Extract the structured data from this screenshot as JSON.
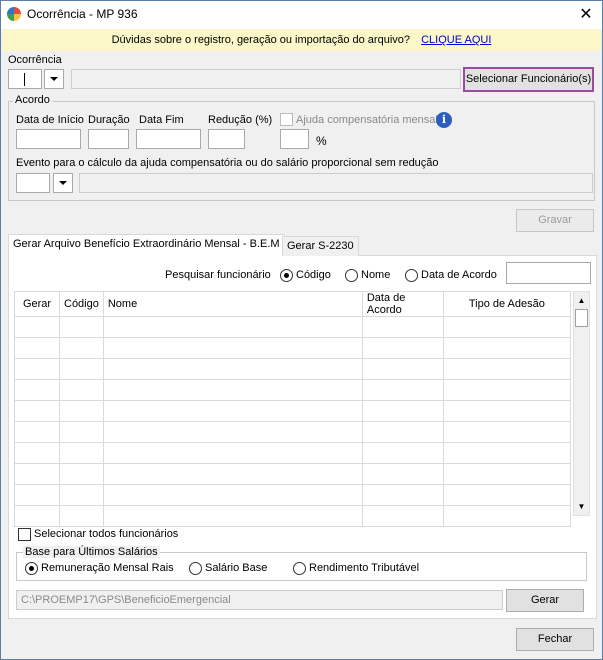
{
  "window": {
    "title": "Ocorrência - MP 936"
  },
  "banner": {
    "text": "Dúvidas sobre o registro, geração ou importação do arquivo?",
    "link": "CLIQUE AQUI"
  },
  "ocorrencia": {
    "label": "Ocorrência",
    "select_button": "Selecionar Funcionário(s)"
  },
  "acordo": {
    "legend": "Acordo",
    "fields": {
      "data_inicio": "Data de Início",
      "duracao": "Duração",
      "data_fim": "Data Fim",
      "reducao": "Redução (%)"
    },
    "ajuda_label": "Ajuda compensatória mensal",
    "percent": "%",
    "evento_label": "Evento para o cálculo da ajuda compensatória ou do salário proporcional sem redução"
  },
  "gravar": "Gravar",
  "tabs": [
    {
      "label": "Gerar Arquivo Benefício Extraordinário Mensal - B.E.M",
      "active": true
    },
    {
      "label": "Gerar S-2230",
      "active": false
    }
  ],
  "search": {
    "label": "Pesquisar funcionário",
    "options": [
      "Código",
      "Nome",
      "Data de Acordo"
    ],
    "selected": "Código"
  },
  "table": {
    "columns": [
      "Gerar",
      "Código",
      "Nome",
      "Data de Acordo",
      "Tipo de Adesão"
    ],
    "empty_rows": 10
  },
  "select_all": "Selecionar todos funcionários",
  "base": {
    "legend": "Base para Últimos Salários",
    "options": [
      "Remuneração Mensal Rais",
      "Salário Base",
      "Rendimento Tributável"
    ],
    "selected": "Remuneração Mensal Rais"
  },
  "path": "C:\\PROEMP17\\GPS\\BeneficioEmergencial",
  "gerar": "Gerar",
  "fechar": "Fechar",
  "colors": {
    "highlight_border": "#9b4aa4",
    "link": "#0000d8",
    "banner_bg": "#fcf7c8"
  }
}
